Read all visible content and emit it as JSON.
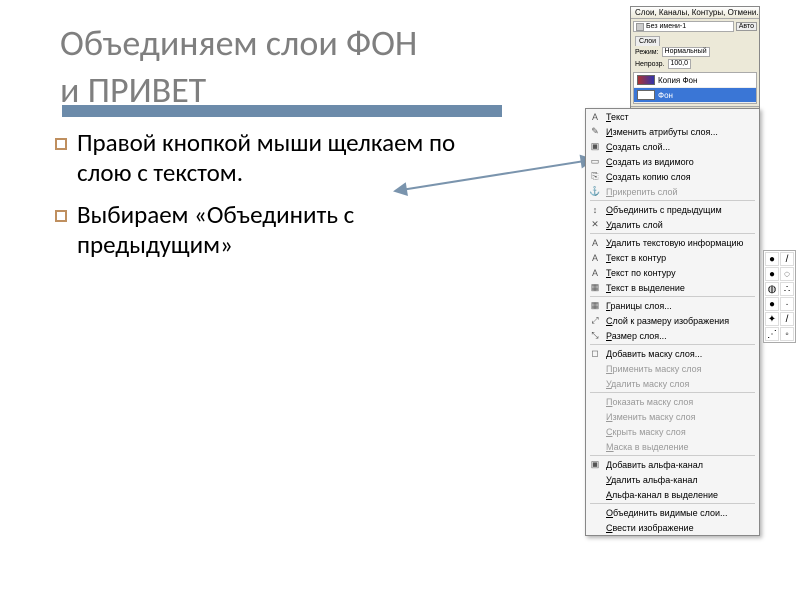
{
  "title_line1": "Объединяем слои ФОН",
  "title_line2": "и ПРИВЕТ",
  "bullets": [
    "Правой кнопкой мыши щелкаем по слою с текстом.",
    "Выбираем «Объединить с предыдущим»"
  ],
  "layers_panel": {
    "title": "Слои, Каналы, Контуры, Отмени...",
    "image_name": "Без имени-1",
    "auto_btn": "Авто",
    "tab": "Слои",
    "mode_label": "Режим:",
    "mode_value": "Нормальный",
    "opacity_label": "Непрозр.",
    "opacity_value": "100,0",
    "layers": [
      {
        "name": "Копия Фон",
        "selected": false
      },
      {
        "name": "Фон",
        "selected": true
      }
    ]
  },
  "ctx": [
    {
      "icon": "A",
      "label": "Текст",
      "dis": false
    },
    {
      "icon": "✎",
      "label": "Изменить атрибуты слоя...",
      "dis": false
    },
    {
      "icon": "▣",
      "label": "Создать слой...",
      "dis": false
    },
    {
      "icon": "▭",
      "label": "Создать из видимого",
      "dis": false
    },
    {
      "icon": "⎘",
      "label": "Создать копию слоя",
      "dis": false
    },
    {
      "icon": "⚓",
      "label": "Прикрепить слой",
      "dis": true
    },
    {
      "sep": true
    },
    {
      "icon": "↕",
      "label": "Объединить с предыдущим",
      "dis": false
    },
    {
      "icon": "✕",
      "label": "Удалить слой",
      "dis": false
    },
    {
      "sep": true
    },
    {
      "icon": "A",
      "label": "Удалить текстовую информацию",
      "dis": false
    },
    {
      "icon": "A",
      "label": "Текст в контур",
      "dis": false
    },
    {
      "icon": "A",
      "label": "Текст по контуру",
      "dis": false
    },
    {
      "icon": "▦",
      "label": "Текст в выделение",
      "dis": false
    },
    {
      "sep": true
    },
    {
      "icon": "▦",
      "label": "Границы слоя...",
      "dis": false
    },
    {
      "icon": "⤢",
      "label": "Слой к размеру изображения",
      "dis": false
    },
    {
      "icon": "⤡",
      "label": "Размер слоя...",
      "dis": false
    },
    {
      "sep": true
    },
    {
      "icon": "◻",
      "label": "Добавить маску слоя...",
      "dis": false
    },
    {
      "icon": "",
      "label": "Применить маску слоя",
      "dis": true
    },
    {
      "icon": "",
      "label": "Удалить маску слоя",
      "dis": true
    },
    {
      "sep": true
    },
    {
      "icon": "",
      "label": "Показать маску слоя",
      "dis": true
    },
    {
      "icon": "",
      "label": "Изменить маску слоя",
      "dis": true
    },
    {
      "icon": "",
      "label": "Скрыть маску слоя",
      "dis": true
    },
    {
      "icon": "",
      "label": "Маска в выделение",
      "dis": true
    },
    {
      "sep": true
    },
    {
      "icon": "▣",
      "label": "Добавить альфа-канал",
      "dis": false
    },
    {
      "icon": "",
      "label": "Удалить альфа-канал",
      "dis": false
    },
    {
      "icon": "",
      "label": "Альфа-канал в выделение",
      "dis": false
    },
    {
      "sep": true
    },
    {
      "icon": "",
      "label": "Объединить видимые слои...",
      "dis": false
    },
    {
      "icon": "",
      "label": "Свести изображение",
      "dis": false
    }
  ]
}
